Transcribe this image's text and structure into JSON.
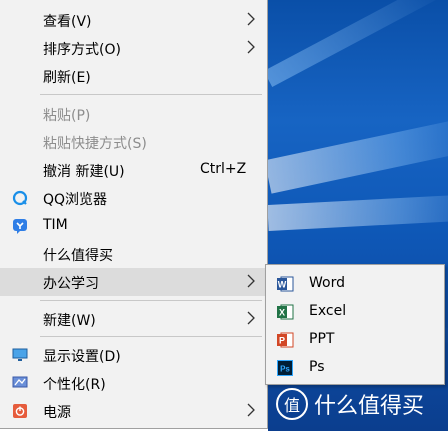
{
  "menu": {
    "items": [
      {
        "label": "查看(V)"
      },
      {
        "label": "排序方式(O)"
      },
      {
        "label": "刷新(E)"
      },
      {
        "label": "粘贴(P)"
      },
      {
        "label": "粘贴快捷方式(S)"
      },
      {
        "label": "撤消 新建(U)",
        "shortcut": "Ctrl+Z"
      },
      {
        "label": "QQ浏览器",
        "icon": "qq-browser-icon"
      },
      {
        "label": "TIM",
        "icon": "tim-icon"
      },
      {
        "label": "什么值得买"
      },
      {
        "label": "办公学习"
      },
      {
        "label": "新建(W)"
      },
      {
        "label": "显示设置(D)",
        "icon": "display-settings-icon"
      },
      {
        "label": "个性化(R)",
        "icon": "personalize-icon"
      },
      {
        "label": "电源",
        "icon": "power-icon"
      }
    ]
  },
  "submenu": {
    "items": [
      {
        "label": "Word",
        "icon": "word-icon",
        "color": "#2b579a"
      },
      {
        "label": "Excel",
        "icon": "excel-icon",
        "color": "#217346"
      },
      {
        "label": "PPT",
        "icon": "powerpoint-icon",
        "color": "#d24726"
      },
      {
        "label": "Ps",
        "icon": "photoshop-icon",
        "color": "#001e36"
      }
    ]
  },
  "watermark": {
    "text": "什么值得买",
    "badge": "值"
  },
  "colors": {
    "menu_bg": "#f2f2f2",
    "highlight": "#dcdcdc",
    "disabled_text": "#8d8d8d",
    "desktop_blue": "#1764c3"
  }
}
